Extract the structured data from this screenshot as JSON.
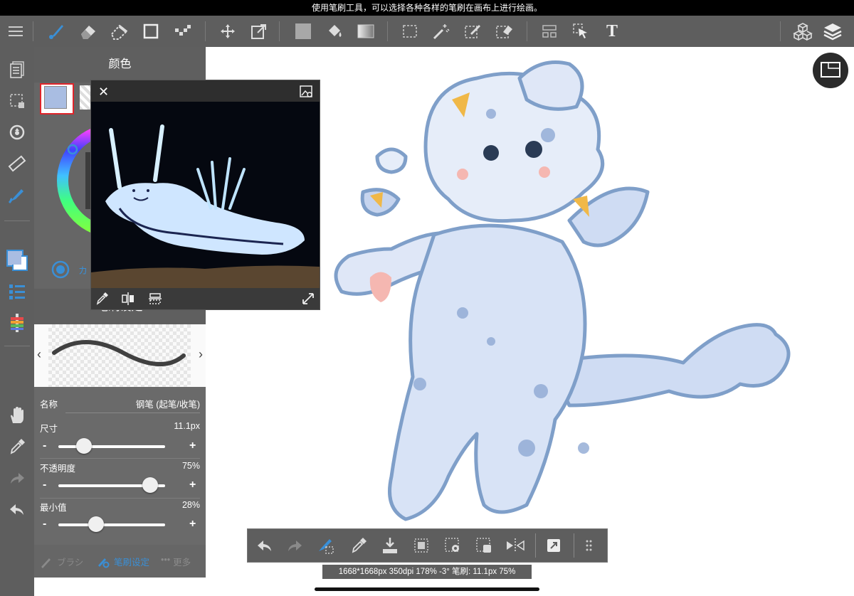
{
  "banner": {
    "text": "使用笔刷工具，可以选择各种各样的笔刷在画布上进行绘画。"
  },
  "toolbar": {
    "tools": [
      "menu-icon",
      "brush-icon",
      "eraser-icon",
      "blur-eraser-icon",
      "rectangle-icon",
      "dot-brush-icon",
      "move-icon",
      "transform-icon",
      "fill-color-icon",
      "bucket-icon",
      "gradient-icon",
      "select-rect-icon",
      "magic-wand-icon",
      "select-pen-icon",
      "select-eraser-icon",
      "snap-icon",
      "select-move-icon",
      "text-icon",
      "materials-icon",
      "layers-icon"
    ],
    "text_tool_label": "T"
  },
  "color_panel": {
    "title": "颜色",
    "current_color": "#a9bde2"
  },
  "brush_panel": {
    "title": "笔刷设定",
    "truncated_label": "カ"
  },
  "brush_props": {
    "name_label": "名称",
    "name_value": "钢笔 (起笔/收笔)",
    "size_label": "尺寸",
    "size_value": "11.1px",
    "size_level": 0.24,
    "opacity_label": "不透明度",
    "opacity_value": "75%",
    "opacity_level": 0.86,
    "min_label": "最小值",
    "min_value": "28%",
    "min_level": 0.35,
    "minus": "-",
    "plus": "+"
  },
  "bottom_tabs": {
    "brush_tab": "ブラシ",
    "settings_tab": "笔刷设定",
    "more_tab": "更多",
    "more_dots": "•••"
  },
  "status": {
    "text": "1668*1668px 350dpi 178% -3° 笔刷: 11.1px 75%"
  },
  "colors": {
    "accent": "#3a8fd6",
    "panel": "#5e5e5e",
    "selected_border": "#e0242a",
    "sketch_line": "#7f9fc9",
    "sketch_fill": "#c9d8f2"
  }
}
